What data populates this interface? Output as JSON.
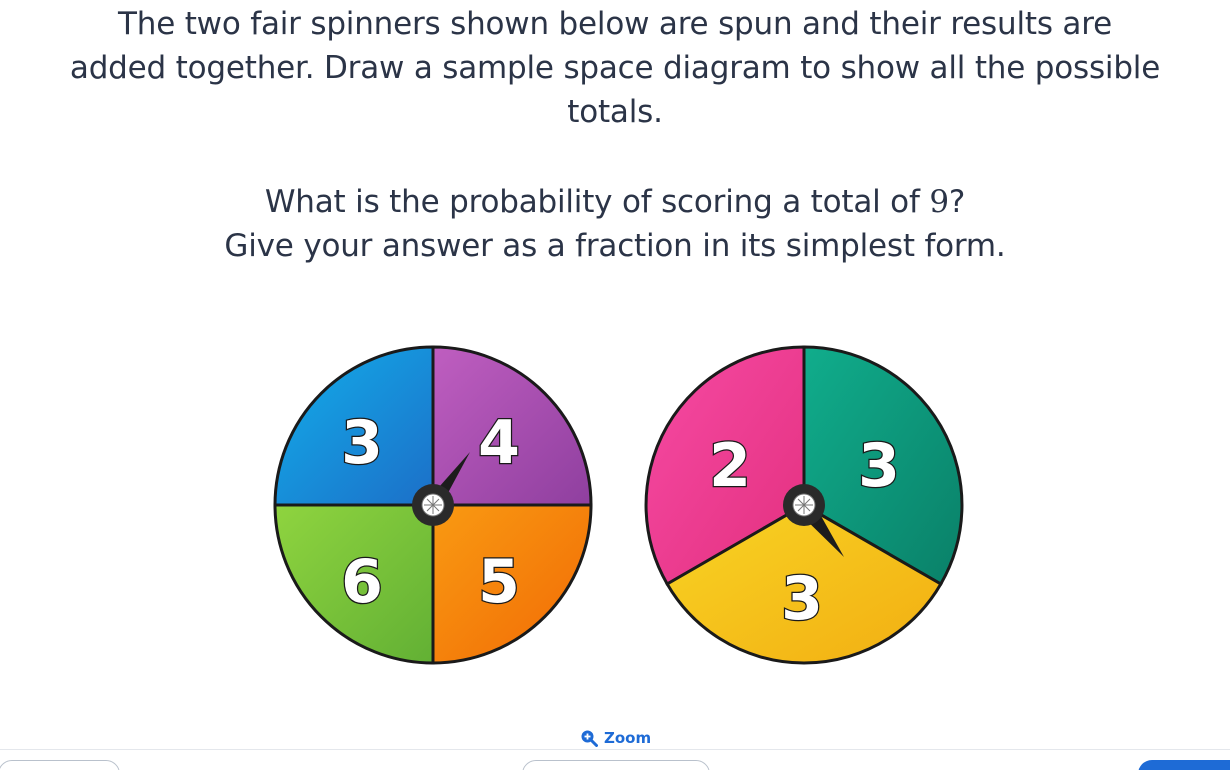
{
  "question": {
    "line1": "The two fair spinners shown below are spun and their results are",
    "line2": "added together. Draw a sample space diagram to show all the possible",
    "line3": "totals.",
    "line4_before": "What is the probability of scoring a total of ",
    "line4_number": "9",
    "line4_after": "?",
    "line5": "Give your answer as a fraction in its simplest form."
  },
  "spinner1": {
    "sections": [
      {
        "label": "3",
        "color": "#1e8fe0"
      },
      {
        "label": "4",
        "color": "#a84fb0"
      },
      {
        "label": "5",
        "color": "#f7810c"
      },
      {
        "label": "6",
        "color": "#7cc43a"
      }
    ]
  },
  "spinner2": {
    "sections": [
      {
        "label": "2",
        "color": "#ef3f97"
      },
      {
        "label": "3",
        "color": "#0c9b80"
      },
      {
        "label": "3",
        "color": "#f5c21b"
      }
    ]
  },
  "zoom": {
    "label": "Zoom",
    "icon": "zoom-in-icon"
  },
  "colors": {
    "accent": "#1e6bd6",
    "text": "#2b3447"
  }
}
